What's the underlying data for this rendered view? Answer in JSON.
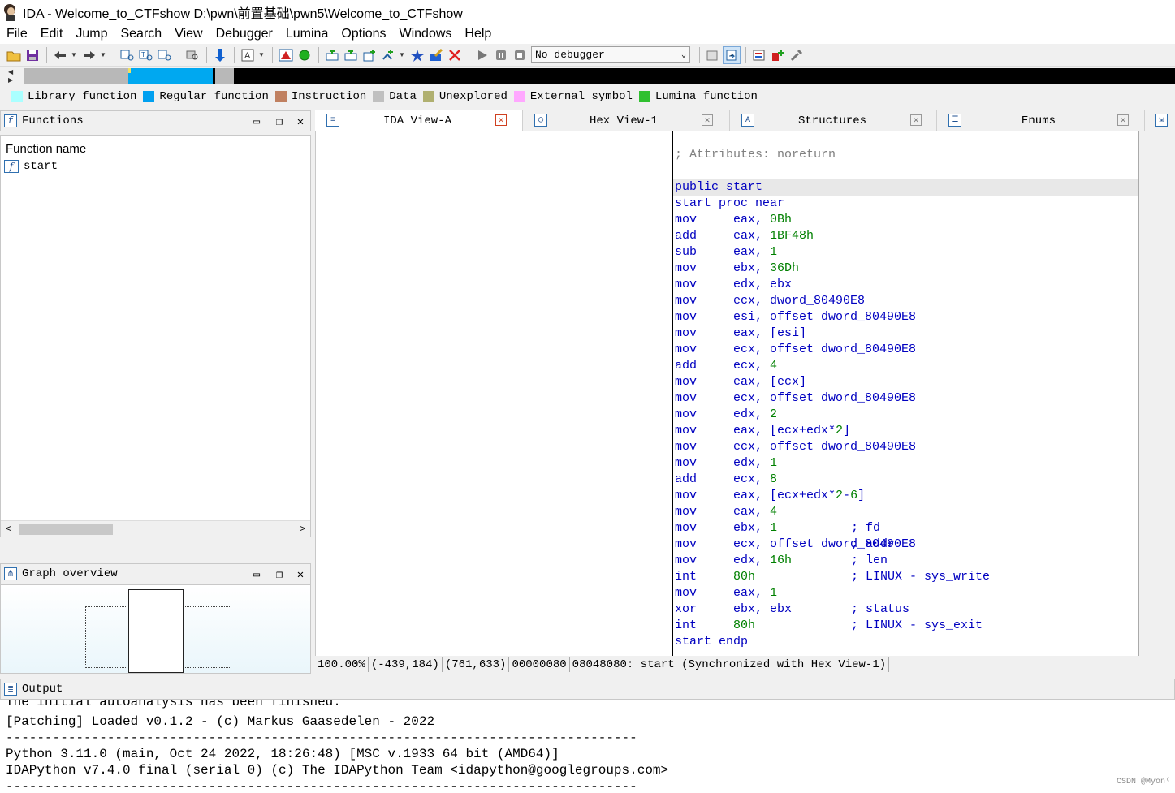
{
  "window": {
    "title": "IDA - Welcome_to_CTFshow D:\\pwn\\前置基础\\pwn5\\Welcome_to_CTFshow"
  },
  "menu": [
    "File",
    "Edit",
    "Jump",
    "Search",
    "View",
    "Debugger",
    "Lumina",
    "Options",
    "Windows",
    "Help"
  ],
  "toolbar": {
    "debugger_value": "No debugger"
  },
  "legend": [
    {
      "label": "Library function",
      "color": "#aaffff"
    },
    {
      "label": "Regular function",
      "color": "#00a0f0"
    },
    {
      "label": "Instruction",
      "color": "#c08060"
    },
    {
      "label": "Data",
      "color": "#c0c0c0"
    },
    {
      "label": "Unexplored",
      "color": "#b0b070"
    },
    {
      "label": "External symbol",
      "color": "#ffa8ff"
    },
    {
      "label": "Lumina function",
      "color": "#30c030"
    }
  ],
  "functions_panel": {
    "title": "Functions",
    "column_header": "Function name",
    "rows": [
      "start"
    ]
  },
  "graph_panel": {
    "title": "Graph overview"
  },
  "tabs": [
    {
      "label": "IDA View-A"
    },
    {
      "label": "Hex View-1"
    },
    {
      "label": "Structures"
    },
    {
      "label": "Enums"
    }
  ],
  "listing": {
    "attributes": "; Attributes: noreturn",
    "public": "public start",
    "proc": "start proc near",
    "instructions": [
      {
        "mn": "mov",
        "op": "eax, 0Bh"
      },
      {
        "mn": "add",
        "op": "eax, 1BF48h"
      },
      {
        "mn": "sub",
        "op": "eax, 1"
      },
      {
        "mn": "mov",
        "op": "ebx, 36Dh"
      },
      {
        "mn": "mov",
        "op": "edx, ebx"
      },
      {
        "mn": "mov",
        "op": "ecx, dword_80490E8"
      },
      {
        "mn": "mov",
        "op": "esi, offset dword_80490E8"
      },
      {
        "mn": "mov",
        "op": "eax, [esi]"
      },
      {
        "mn": "mov",
        "op": "ecx, offset dword_80490E8"
      },
      {
        "mn": "add",
        "op": "ecx, 4"
      },
      {
        "mn": "mov",
        "op": "eax, [ecx]"
      },
      {
        "mn": "mov",
        "op": "ecx, offset dword_80490E8"
      },
      {
        "mn": "mov",
        "op": "edx, 2"
      },
      {
        "mn": "mov",
        "op": "eax, [ecx+edx*2]"
      },
      {
        "mn": "mov",
        "op": "ecx, offset dword_80490E8"
      },
      {
        "mn": "mov",
        "op": "edx, 1"
      },
      {
        "mn": "add",
        "op": "ecx, 8"
      },
      {
        "mn": "mov",
        "op": "eax, [ecx+edx*2-6]"
      },
      {
        "mn": "mov",
        "op": "eax, 4"
      },
      {
        "mn": "mov",
        "op": "ebx, 1",
        "cmt": "; fd"
      },
      {
        "mn": "mov",
        "op": "ecx, offset dword_80490E8",
        "cmt": "; addr"
      },
      {
        "mn": "mov",
        "op": "edx, 16h",
        "cmt": "; len"
      },
      {
        "mn": "int",
        "op": "80h",
        "cmt": "; LINUX - sys_write"
      },
      {
        "mn": "mov",
        "op": "eax, 1"
      },
      {
        "mn": "xor",
        "op": "ebx, ebx",
        "cmt": "; status"
      },
      {
        "mn": "int",
        "op": "80h",
        "cmt": "; LINUX - sys_exit"
      }
    ],
    "endp": "start endp"
  },
  "status": {
    "zoom": "100.00%",
    "coords1": "(-439,184)",
    "coords2": "(761,633)",
    "offset": "00000080",
    "location": "08048080: start (Synchronized with Hex View-1)"
  },
  "output_panel": {
    "title": "Output",
    "lines": [
      "The initial autoanalysis has been finished.",
      "[Patching] Loaded v0.1.2 - (c) Markus Gaasedelen - 2022",
      "---------------------------------------------------------------------------------",
      "Python 3.11.0 (main, Oct 24 2022, 18:26:48) [MSC v.1933 64 bit (AMD64)]",
      "IDAPython v7.4.0 final (serial 0) (c) The IDAPython Team <idapython@googlegroups.com>",
      "---------------------------------------------------------------------------------"
    ]
  },
  "watermark": "CSDN @Myon⁽"
}
